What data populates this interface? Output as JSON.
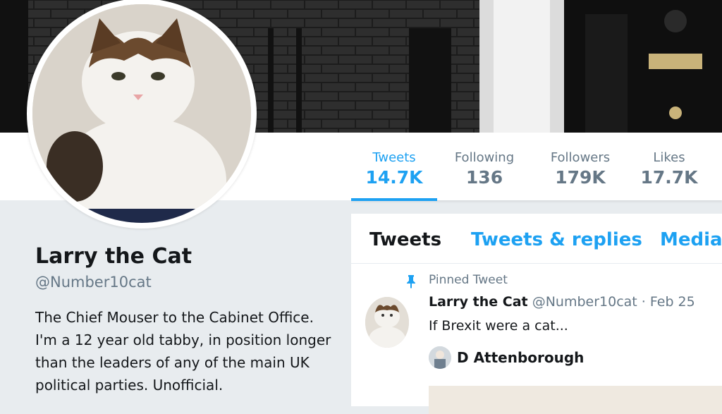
{
  "profile": {
    "name": "Larry the Cat",
    "handle": "@Number10cat",
    "bio": "The Chief Mouser to the Cabinet Office. I'm a 12 year old tabby, in position longer than the leaders of any of the main UK political parties. Unofficial."
  },
  "stats": [
    {
      "label": "Tweets",
      "value": "14.7K",
      "active": true
    },
    {
      "label": "Following",
      "value": "136",
      "active": false
    },
    {
      "label": "Followers",
      "value": "179K",
      "active": false
    },
    {
      "label": "Likes",
      "value": "17.7K",
      "active": false
    }
  ],
  "tabs": [
    {
      "label": "Tweets",
      "active": true
    },
    {
      "label": "Tweets & replies",
      "active": false
    },
    {
      "label": "Media",
      "active": false
    }
  ],
  "pinned_tweet": {
    "pinned_label": "Pinned Tweet",
    "author_name": "Larry the Cat",
    "author_handle": "@Number10cat",
    "separator": "·",
    "date": "Feb 25",
    "text": "If Brexit were a cat...",
    "quoted_name": "D Attenborough"
  },
  "colors": {
    "accent": "#1da1f2",
    "text_primary": "#14171a",
    "text_secondary": "#657786"
  },
  "icons": {
    "pin": "pin-icon"
  }
}
